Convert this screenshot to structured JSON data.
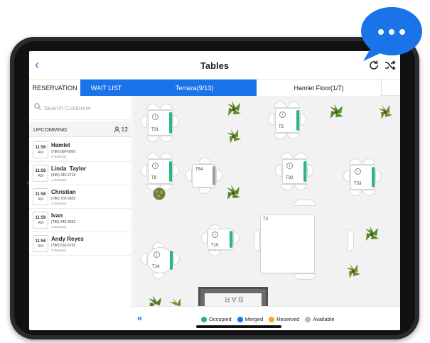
{
  "header": {
    "title": "Tables"
  },
  "sidebar_tabs": {
    "reservation": "RESERVATION",
    "wait_list": "WAIT LIST"
  },
  "floor_tabs": [
    "Terraza(9/13)",
    "Hamlet Floor(1/7)"
  ],
  "search": {
    "placeholder": "Search Customer"
  },
  "upcoming": {
    "label": "UPCOMMING",
    "count": "12"
  },
  "reservations": [
    {
      "time": "11:56",
      "ampm": "AM",
      "name": "Hamlet",
      "phone": "(786) 890-6869",
      "guests": "2 Guest(s)"
    },
    {
      "time": "11:56",
      "ampm": "AM",
      "name": "Linda  Taylor",
      "phone": "(305) 240-2718",
      "guests": "2 Guest(s)"
    },
    {
      "time": "11:56",
      "ampm": "AM",
      "name": "Christian",
      "phone": "(786) 702-5829",
      "guests": "2 Guest(s)"
    },
    {
      "time": "11:56",
      "ampm": "AM",
      "name": "Ivan",
      "phone": "(786) 440-2652",
      "guests": "3 Guest(s)"
    },
    {
      "time": "11:56",
      "ampm": "AM",
      "name": "Andy Reyes",
      "phone": "(786) 632-6726",
      "guests": "3 Guest(s)"
    }
  ],
  "tables": {
    "t31": "T31",
    "t3": "T3",
    "t9": "T9",
    "t54": "T54",
    "t32": "T32",
    "t33": "T33",
    "t2": "T2",
    "t15": "T15",
    "t14": "T14"
  },
  "bar_label": "BAR",
  "legend": {
    "occupied": {
      "label": "Occupied",
      "color": "#27b783"
    },
    "merged": {
      "label": "Merged",
      "color": "#1a73e8"
    },
    "reserved": {
      "label": "Reserved",
      "color": "#f5a623"
    },
    "available": {
      "label": "Available",
      "color": "#b9b9b9"
    }
  },
  "colors": {
    "accent": "#1a73e8",
    "occupied": "#27b783",
    "chat_bubble": "#1a73e8"
  },
  "icons": [
    "back-chevron-icon",
    "refresh-icon",
    "shuffle-icon",
    "search-icon",
    "guests-icon",
    "info-icon",
    "plant-icon",
    "collapse-double-chevron-icon",
    "chat-bubble-icon"
  ]
}
